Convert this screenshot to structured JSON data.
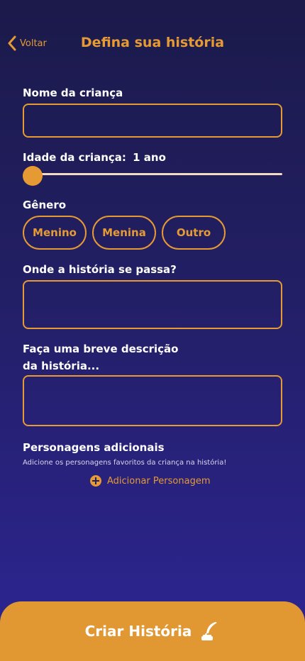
{
  "header": {
    "back_label": "Voltar",
    "title": "Defina sua história"
  },
  "form": {
    "name_label": "Nome da criança",
    "name_value": "",
    "age_label": "Idade da criança:",
    "age_value": "1 ano",
    "age_slider_fraction": 0.0,
    "gender_label": "Gênero",
    "gender_options": [
      "Menino",
      "Menina",
      "Outro"
    ],
    "location_label": "Onde a história se passa?",
    "location_value": "",
    "description_label_line1": "Faça uma breve descrição",
    "description_label_line2": "da história...",
    "description_value": "",
    "characters_label": "Personagens adicionais",
    "characters_hint": "Adicione os personagens favoritos da criança na história!",
    "add_character_label": "Adicionar Personagem"
  },
  "cta": {
    "label": "Criar História",
    "icon": "quill-ink-icon"
  },
  "colors": {
    "accent": "#e59a34",
    "background_top": "#1b1a4a",
    "background_bottom": "#2d2594",
    "text": "#ffffff"
  }
}
